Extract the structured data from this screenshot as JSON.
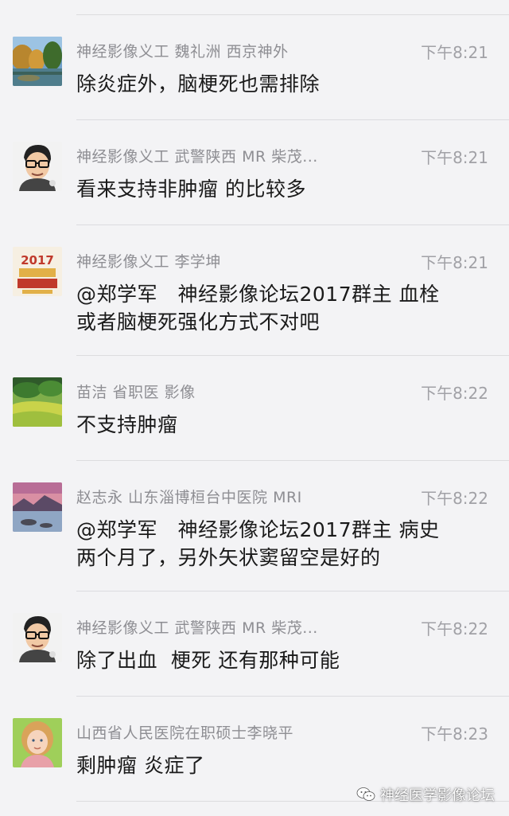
{
  "messages": [
    {
      "sender": "神经影像义工 魏礼洲 西京神外",
      "time": "下午8:21",
      "lines": [
        "除炎症外，脑梗死也需排除"
      ],
      "avatar": "landscape-trees-avatar"
    },
    {
      "sender": "神经影像义工 武警陕西 MR 柴茂...",
      "time": "下午8:21",
      "lines": [
        "看来支持非肿瘤 的比较多"
      ],
      "avatar": "cartoon-man-avatar"
    },
    {
      "sender": "神经影像义工 李学坤",
      "time": "下午8:21",
      "lines": [
        "@郑学军　神经影像论坛2017群主 血栓",
        "或者脑梗死强化方式不对吧"
      ],
      "avatar": "calendar-2017-avatar"
    },
    {
      "sender": "苗洁 省职医 影像",
      "time": "下午8:22",
      "lines": [
        "不支持肿瘤"
      ],
      "avatar": "green-field-avatar"
    },
    {
      "sender": "赵志永 山东淄博桓台中医院 MRI",
      "time": "下午8:22",
      "lines": [
        "@郑学军　神经影像论坛2017群主 病史",
        "两个月了，另外矢状窦留空是好的"
      ],
      "avatar": "lake-sunset-avatar"
    },
    {
      "sender": "神经影像义工 武警陕西 MR 柴茂...",
      "time": "下午8:22",
      "lines": [
        "除了出血  梗死 还有那种可能"
      ],
      "avatar": "cartoon-man-avatar"
    },
    {
      "sender": "山西省人民医院在职硕士李晓平",
      "time": "下午8:23",
      "lines": [
        "剩肿瘤 炎症了"
      ],
      "avatar": "girl-photo-avatar"
    }
  ],
  "avatar_texts": {
    "calendar_year": "2017"
  },
  "watermark": {
    "label": "神经医学影像论坛",
    "icon": "wechat-icon"
  },
  "colors": {
    "background": "#f3f3f5",
    "sender": "#8e8e93",
    "time": "#a1a1a6",
    "text": "#1a1a1a",
    "divider": "#dcdcdf"
  }
}
